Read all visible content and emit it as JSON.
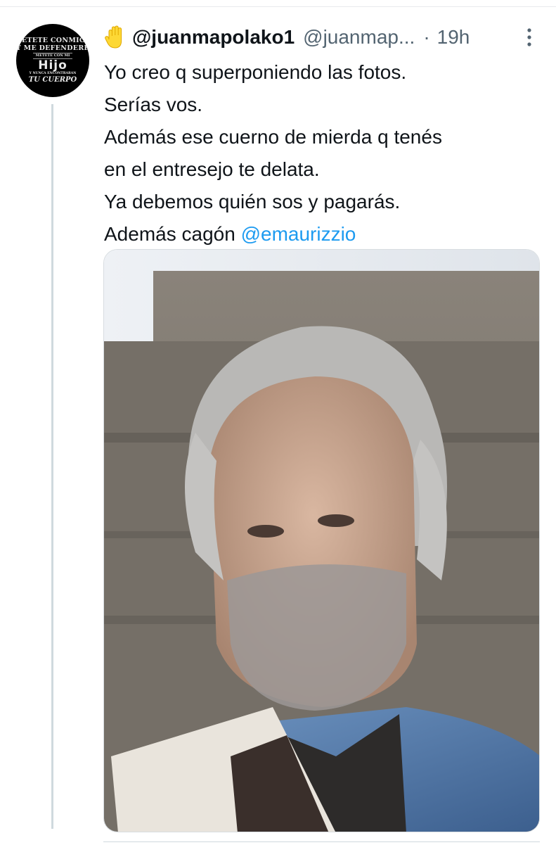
{
  "tweet": {
    "avatar_text": {
      "line1": "METETE CONMIGO",
      "line2": "Y ME DEFENDERE",
      "line3": "METETE CON MI",
      "line4": "Hijo",
      "line5": "Y NUNCA ENCONTRARAN",
      "line6": "TU CUERPO"
    },
    "display_name": "@juanmapolako1",
    "handle": "@juanmap...",
    "separator": "·",
    "time": "19h",
    "text_lines": [
      "Yo creo q superponiendo las fotos.",
      "Serías vos.",
      "Además ese cuerno de mierda q tenés",
      "en el entresejo te delata.",
      "Ya debemos quién sos y pagarás."
    ],
    "last_line_prefix": "Además cagón",
    "mention": "@emaurizzio",
    "icons": {
      "name_emoji": "raised-hand",
      "more": "vertical-ellipsis"
    },
    "colors": {
      "link": "#1d9bf0",
      "secondary_text": "#536471",
      "thread_line": "#cfd9de"
    }
  }
}
